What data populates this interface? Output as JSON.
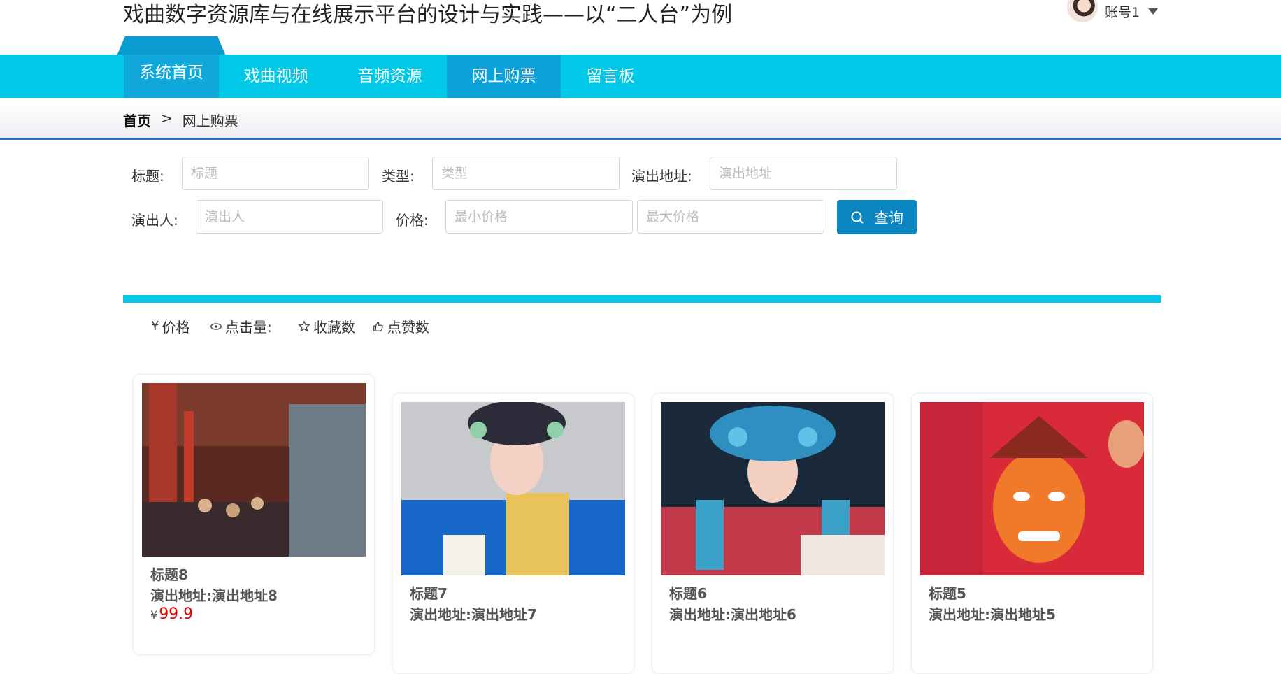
{
  "header": {
    "title": "戏曲数字资源库与在线展示平台的设计与实践——以“二人台”为例",
    "account": "账号1"
  },
  "nav": {
    "items": [
      "系统首页",
      "戏曲视频",
      "音频资源",
      "网上购票",
      "留言板"
    ],
    "active": "网上购票"
  },
  "breadcrumb": {
    "home": "首页",
    "sep": ">",
    "current": "网上购票"
  },
  "search": {
    "title_label": "标题:",
    "title_placeholder": "标题",
    "type_label": "类型:",
    "type_placeholder": "类型",
    "addr_label": "演出地址:",
    "addr_placeholder": "演出地址",
    "performer_label": "演出人:",
    "performer_placeholder": "演出人",
    "price_label": "价格:",
    "min_placeholder": "最小价格",
    "max_placeholder": "最大价格",
    "button": "查询"
  },
  "colors": {
    "nav": "#00c8e6",
    "active_tab": "#0aa2d8",
    "button": "#0b86c0",
    "price": "#e00000"
  },
  "sort": {
    "price": "价格",
    "clicks": "点击量:",
    "favorites": "收藏数",
    "likes": "点赞数"
  },
  "cards": [
    {
      "title": "标题8",
      "address": "演出地址:演出地址8",
      "price_symbol": "¥",
      "price": "99.9"
    },
    {
      "title": "标题7",
      "address": "演出地址:演出地址7"
    },
    {
      "title": "标题6",
      "address": "演出地址:演出地址6"
    },
    {
      "title": "标题5",
      "address": "演出地址:演出地址5"
    }
  ]
}
